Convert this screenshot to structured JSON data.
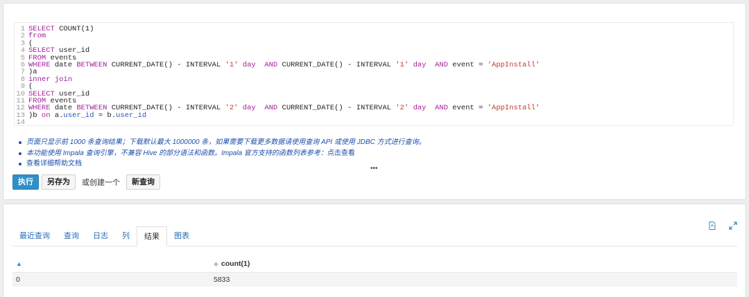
{
  "editor": {
    "lines": [
      [
        {
          "t": "kw",
          "v": "SELECT"
        },
        {
          "t": "fn",
          "v": " COUNT"
        },
        {
          "t": "fn",
          "v": "(1)"
        }
      ],
      [
        {
          "t": "kw",
          "v": "from"
        }
      ],
      [
        {
          "t": "fn",
          "v": "("
        }
      ],
      [
        {
          "t": "kw",
          "v": "SELECT"
        },
        {
          "t": "fn",
          "v": " user_id"
        }
      ],
      [
        {
          "t": "kw",
          "v": "FROM"
        },
        {
          "t": "fn",
          "v": " events"
        }
      ],
      [
        {
          "t": "kw",
          "v": "WHERE"
        },
        {
          "t": "fn",
          "v": " date "
        },
        {
          "t": "kw",
          "v": "BETWEEN"
        },
        {
          "t": "fn",
          "v": " CURRENT_DATE() - INTERVAL "
        },
        {
          "t": "str",
          "v": "'1'"
        },
        {
          "t": "kw",
          "v": " day"
        },
        {
          "t": "fn",
          "v": "  "
        },
        {
          "t": "kw",
          "v": "AND"
        },
        {
          "t": "fn",
          "v": " CURRENT_DATE() - INTERVAL "
        },
        {
          "t": "str",
          "v": "'1'"
        },
        {
          "t": "kw",
          "v": " day"
        },
        {
          "t": "fn",
          "v": "  "
        },
        {
          "t": "kw",
          "v": "AND"
        },
        {
          "t": "fn",
          "v": " event = "
        },
        {
          "t": "str",
          "v": "'AppInstall'"
        }
      ],
      [
        {
          "t": "fn",
          "v": ")a"
        }
      ],
      [
        {
          "t": "kw",
          "v": "inner join"
        }
      ],
      [
        {
          "t": "fn",
          "v": "("
        }
      ],
      [
        {
          "t": "kw",
          "v": "SELECT"
        },
        {
          "t": "fn",
          "v": " user_id"
        }
      ],
      [
        {
          "t": "kw",
          "v": "FROM"
        },
        {
          "t": "fn",
          "v": " events"
        }
      ],
      [
        {
          "t": "kw",
          "v": "WHERE"
        },
        {
          "t": "fn",
          "v": " date "
        },
        {
          "t": "kw",
          "v": "BETWEEN"
        },
        {
          "t": "fn",
          "v": " CURRENT_DATE() - INTERVAL "
        },
        {
          "t": "str",
          "v": "'2'"
        },
        {
          "t": "kw",
          "v": " day"
        },
        {
          "t": "fn",
          "v": "  "
        },
        {
          "t": "kw",
          "v": "AND"
        },
        {
          "t": "fn",
          "v": " CURRENT_DATE() - INTERVAL "
        },
        {
          "t": "str",
          "v": "'2'"
        },
        {
          "t": "kw",
          "v": " day"
        },
        {
          "t": "fn",
          "v": "  "
        },
        {
          "t": "kw",
          "v": "AND"
        },
        {
          "t": "fn",
          "v": " event = "
        },
        {
          "t": "str",
          "v": "'AppInstall'"
        }
      ],
      [
        {
          "t": "fn",
          "v": ")b "
        },
        {
          "t": "kw",
          "v": "on"
        },
        {
          "t": "fn",
          "v": " a."
        },
        {
          "t": "id",
          "v": "user_id"
        },
        {
          "t": "fn",
          "v": " = b."
        },
        {
          "t": "id",
          "v": "user_id"
        }
      ],
      []
    ]
  },
  "notes": {
    "n1": "页面只显示前 1000 条查询结果；下载默认最大 1000000 条，如果需要下载更多数据请使用查询 API 或使用 JDBC 方式进行查询。",
    "n2": "本功能使用 Impala 查询引擎，不兼容 Hive 的部分语法和函数。Impala 官方支持的函数列表参考：",
    "n2_link": "点击查看",
    "n3": "查看详细帮助文档"
  },
  "ellipsis": "•••",
  "actions": {
    "run": "执行",
    "save_as": "另存为",
    "or_create": "或创建一个",
    "new_query": "新查询"
  },
  "results": {
    "tabs": [
      "最近查询",
      "查询",
      "日志",
      "列",
      "结果",
      "图表"
    ],
    "active_tab": "结果",
    "header": [
      "",
      "count(1)"
    ],
    "rows": [
      [
        "0",
        "5833"
      ]
    ]
  }
}
